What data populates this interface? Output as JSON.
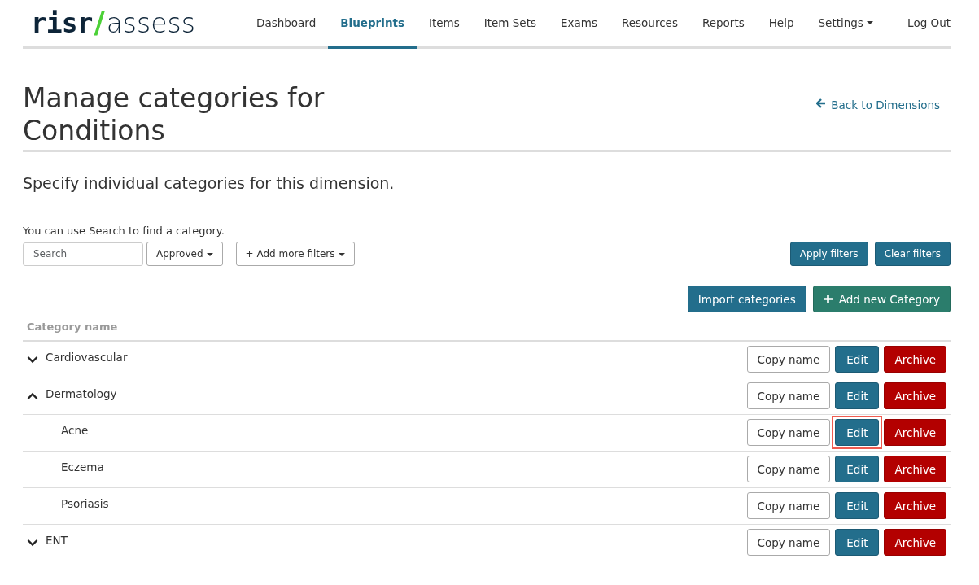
{
  "logo": {
    "part_1": "risr",
    "part_2": "/",
    "part_3": "assess"
  },
  "nav": [
    {
      "label": "Dashboard",
      "selected": false
    },
    {
      "label": "Blueprints",
      "selected": true
    },
    {
      "label": "Items",
      "selected": false
    },
    {
      "label": "Item Sets",
      "selected": false
    },
    {
      "label": "Exams",
      "selected": false
    },
    {
      "label": "Resources",
      "selected": false
    },
    {
      "label": "Reports",
      "selected": false
    },
    {
      "label": "Help",
      "selected": false
    },
    {
      "label": "Settings",
      "selected": false,
      "dropdown": true
    }
  ],
  "logout": "Log Out",
  "title": "Manage categories for Conditions",
  "back_link": "Back to Dimensions",
  "subtitle": "Specify individual categories for this dimension.",
  "search_hint": "You can use Search to find a category.",
  "search": {
    "placeholder": "Search"
  },
  "status_filter": "Approved",
  "more_filters": "+ Add more filters",
  "apply_filters": "Apply filters",
  "clear_filters": "Clear filters",
  "import_button": "Import categories",
  "add_button": "Add new Category",
  "table": {
    "column": "Category name",
    "rows": [
      {
        "name": "Cardiovascular",
        "expanded": false,
        "copy": "Copy name",
        "edit": "Edit",
        "archive": "Archive",
        "highlighted": false
      },
      {
        "name": "Dermatology",
        "expanded": true,
        "copy": "Copy name",
        "edit": "Edit",
        "archive": "Archive",
        "highlighted": false,
        "children": [
          {
            "name": "Acne",
            "copy": "Copy name",
            "edit": "Edit",
            "archive": "Archive",
            "highlighted": true
          },
          {
            "name": "Eczema",
            "copy": "Copy name",
            "edit": "Edit",
            "archive": "Archive",
            "highlighted": false
          },
          {
            "name": "Psoriasis",
            "copy": "Copy name",
            "edit": "Edit",
            "archive": "Archive",
            "highlighted": false
          }
        ]
      },
      {
        "name": "ENT",
        "expanded": false,
        "copy": "Copy name",
        "edit": "Edit",
        "archive": "Archive",
        "highlighted": false
      }
    ]
  }
}
